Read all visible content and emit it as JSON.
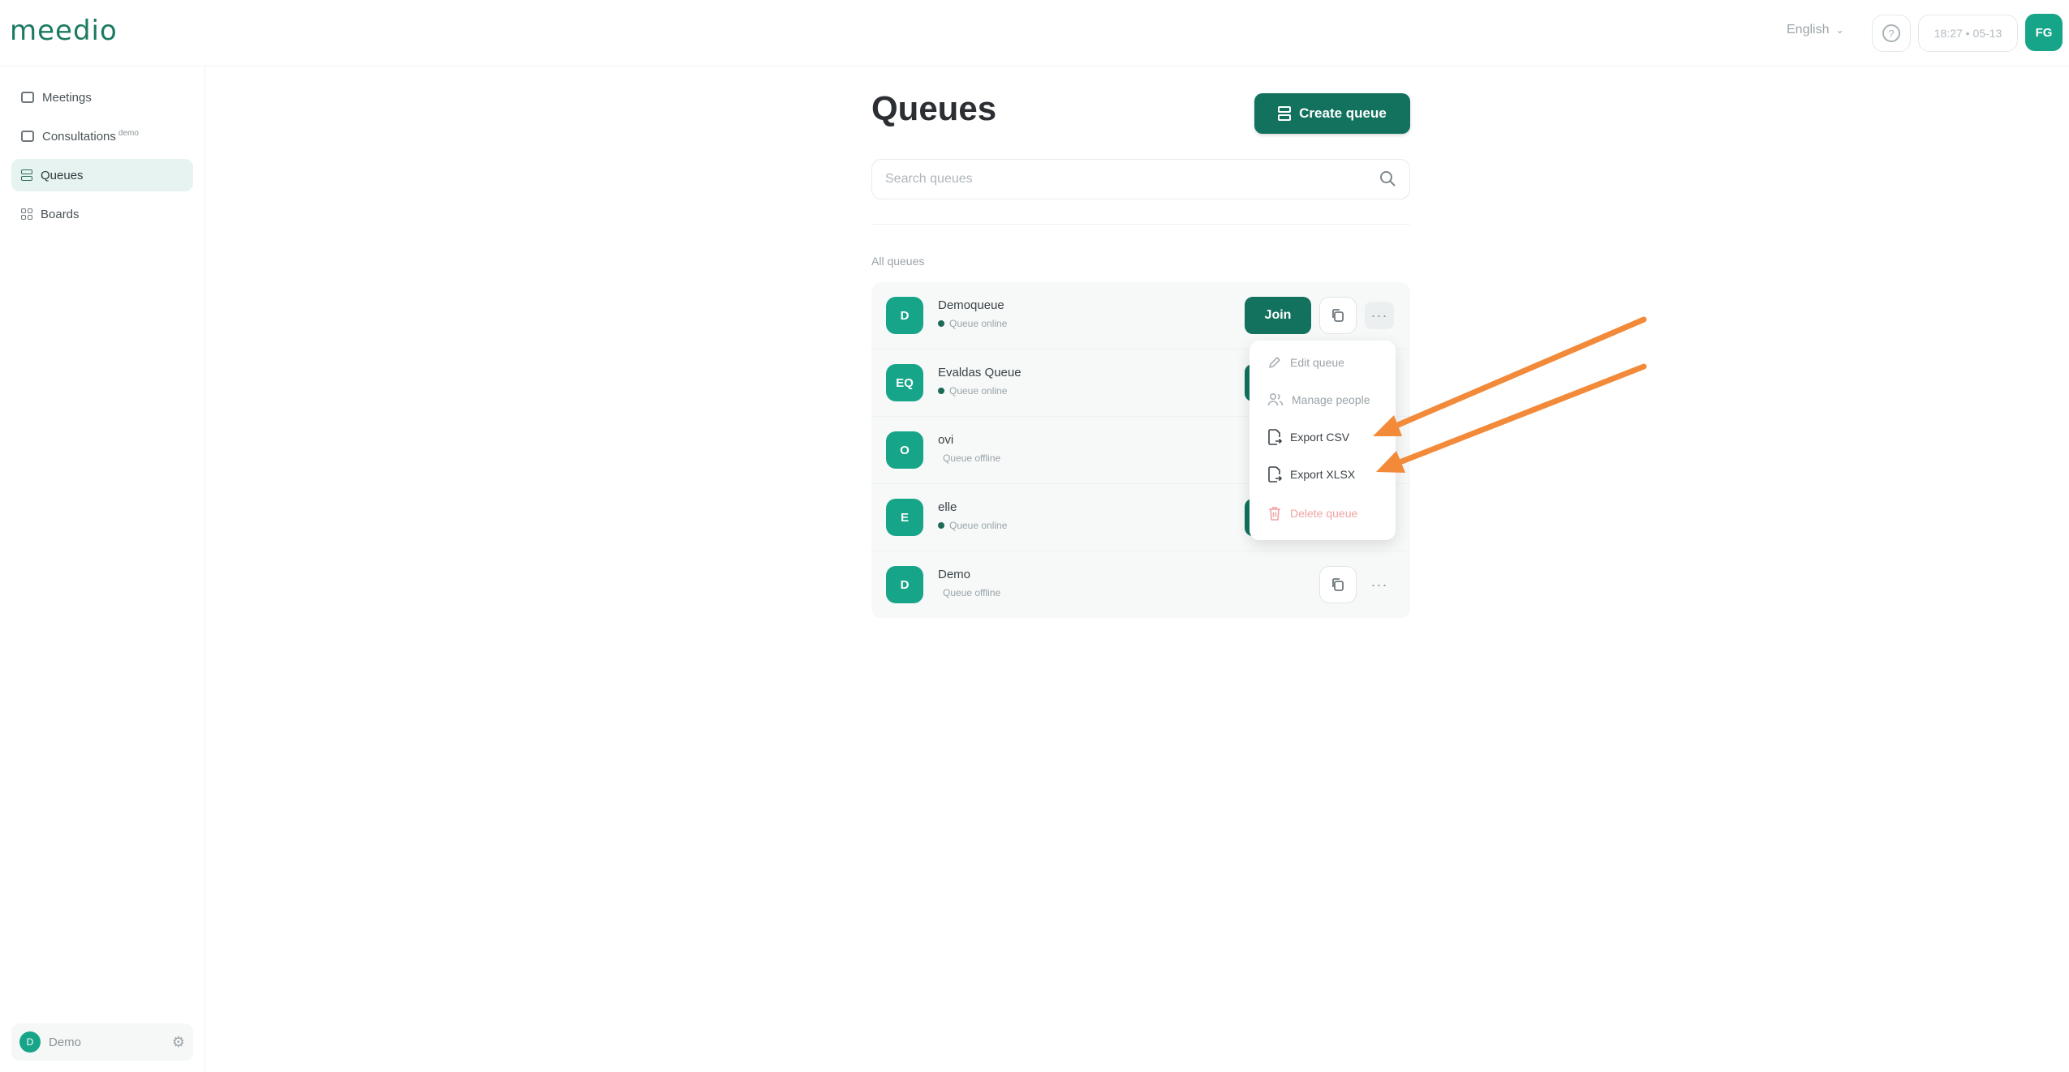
{
  "header": {
    "logo": "meedio",
    "language": "English",
    "clock": "18:27 • 05-13",
    "user_initials": "FG"
  },
  "sidebar": {
    "items": [
      {
        "label": "Meetings",
        "icon": "video-icon"
      },
      {
        "label": "Consultations",
        "badge": "demo",
        "icon": "consultation-icon"
      },
      {
        "label": "Queues",
        "icon": "queue-icon",
        "active": true
      },
      {
        "label": "Boards",
        "icon": "grid-icon"
      }
    ],
    "footer": {
      "initial": "D",
      "name": "Demo"
    }
  },
  "main": {
    "title": "Queues",
    "create_label": "Create queue",
    "search_placeholder": "Search queues",
    "section_label": "All queues",
    "queues": [
      {
        "initials": "D",
        "name": "Demoqueue",
        "status": "Queue online",
        "online": true
      },
      {
        "initials": "EQ",
        "name": "Evaldas Queue",
        "status": "Queue online",
        "online": true
      },
      {
        "initials": "O",
        "name": "ovi",
        "status": "Queue offline",
        "online": false
      },
      {
        "initials": "E",
        "name": "elle",
        "status": "Queue online",
        "online": true
      },
      {
        "initials": "D",
        "name": "Demo",
        "status": "Queue offline",
        "online": false
      }
    ],
    "join_label": "Join",
    "more_label": "···"
  },
  "menu": {
    "items": [
      {
        "label": "Edit queue",
        "icon": "pencil-icon"
      },
      {
        "label": "Manage people",
        "icon": "people-icon"
      },
      {
        "label": "Export CSV",
        "icon": "file-export-icon"
      },
      {
        "label": "Export XLSX",
        "icon": "file-export-icon"
      },
      {
        "label": "Delete queue",
        "icon": "trash-icon"
      }
    ]
  },
  "colors": {
    "brand": "#12725d",
    "avatar": "#17a589",
    "annotation_arrow": "#f28a3a"
  }
}
